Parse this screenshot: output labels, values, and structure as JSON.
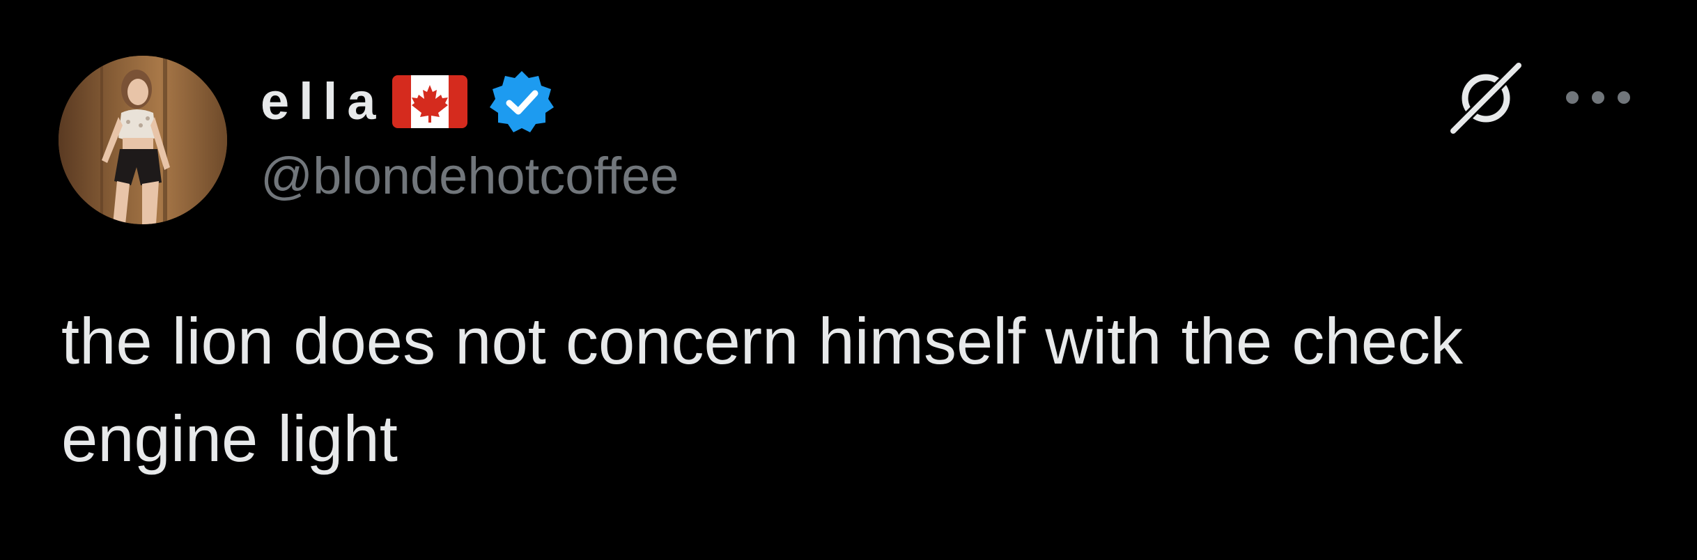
{
  "tweet": {
    "author": {
      "display_name": "ella",
      "flag": "canada-flag",
      "verified": true,
      "handle": "@blondehotcoffee"
    },
    "text": "the lion does not concern himself with the check engine light",
    "actions": {
      "grok_icon": "grok-icon",
      "more_icon": "more-options-icon"
    }
  },
  "colors": {
    "background": "#000000",
    "primary_text": "#e7e9ea",
    "secondary_text": "#71767b",
    "verified_blue": "#1d9bf0",
    "flag_red": "#d52b1e"
  }
}
